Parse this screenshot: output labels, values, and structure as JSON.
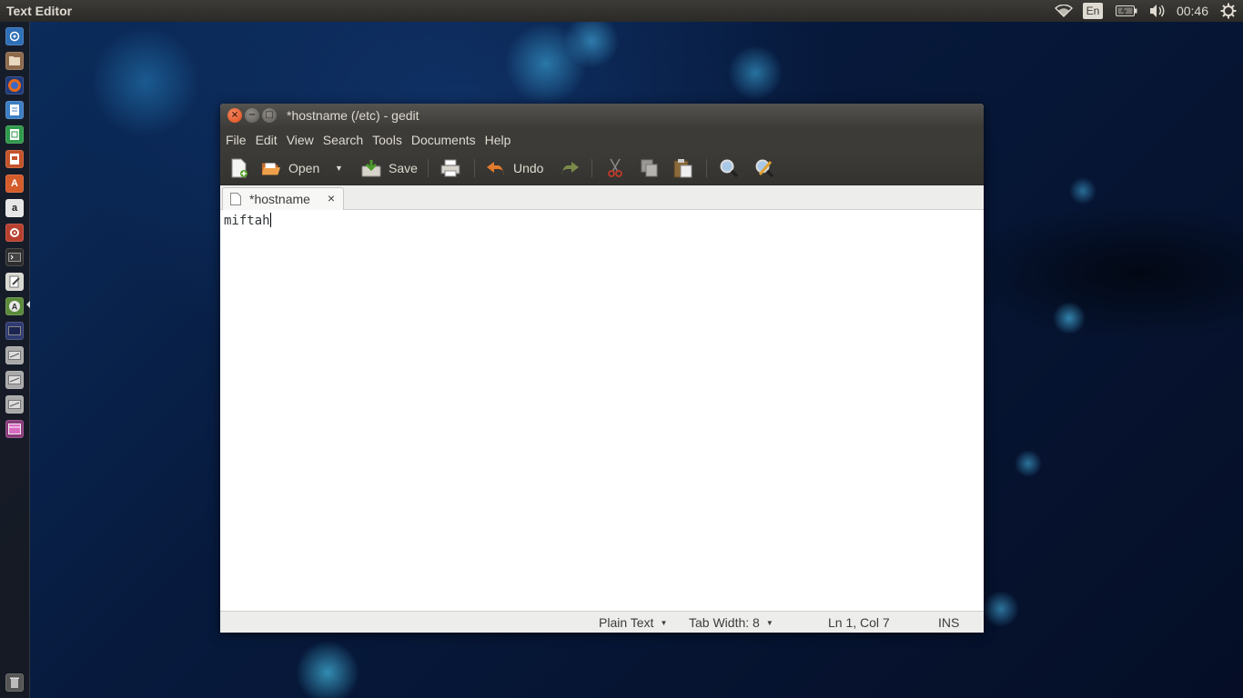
{
  "top_panel": {
    "app_title": "Text Editor",
    "language": "En",
    "clock": "00:46",
    "icons": [
      "wifi-icon",
      "battery-icon",
      "volume-icon",
      "gear-icon"
    ]
  },
  "launcher": {
    "items": [
      {
        "name": "dash-home",
        "color": "#2f6fb7"
      },
      {
        "name": "files",
        "color": "#9a6a44"
      },
      {
        "name": "firefox",
        "color": "#e56a1c"
      },
      {
        "name": "writer",
        "color": "#3d7ec3"
      },
      {
        "name": "calc",
        "color": "#2f9a4b"
      },
      {
        "name": "impress",
        "color": "#c4542a"
      },
      {
        "name": "software-center",
        "color": "#d45b2a"
      },
      {
        "name": "amazon",
        "color": "#dcdcdc"
      },
      {
        "name": "settings",
        "color": "#b8402f"
      },
      {
        "name": "terminal",
        "color": "#2d2d2d"
      },
      {
        "name": "text-editor",
        "color": "#d9d9d2"
      },
      {
        "name": "software-updater",
        "color": "#5a8a3a"
      },
      {
        "name": "mail",
        "color": "#4a4f8a"
      },
      {
        "name": "drive-1",
        "color": "#b9b9b9"
      },
      {
        "name": "drive-2",
        "color": "#b9b9b9"
      },
      {
        "name": "drive-3",
        "color": "#b9b9b9"
      },
      {
        "name": "workspace-switcher",
        "color": "#8a3a7a"
      }
    ],
    "trash": "trash"
  },
  "window": {
    "title": "*hostname (/etc) - gedit",
    "buttons": {
      "close": "×",
      "minimize": "−",
      "maximize": "□"
    },
    "menu": [
      "File",
      "Edit",
      "View",
      "Search",
      "Tools",
      "Documents",
      "Help"
    ],
    "toolbar": {
      "open_label": "Open",
      "save_label": "Save",
      "undo_label": "Undo"
    },
    "tab": {
      "label": "*hostname",
      "close": "×"
    },
    "editor": {
      "content": "miftah"
    },
    "statusbar": {
      "language": "Plain Text",
      "tab_width": "Tab Width: 8",
      "position": "Ln 1, Col 7",
      "mode": "INS"
    }
  }
}
